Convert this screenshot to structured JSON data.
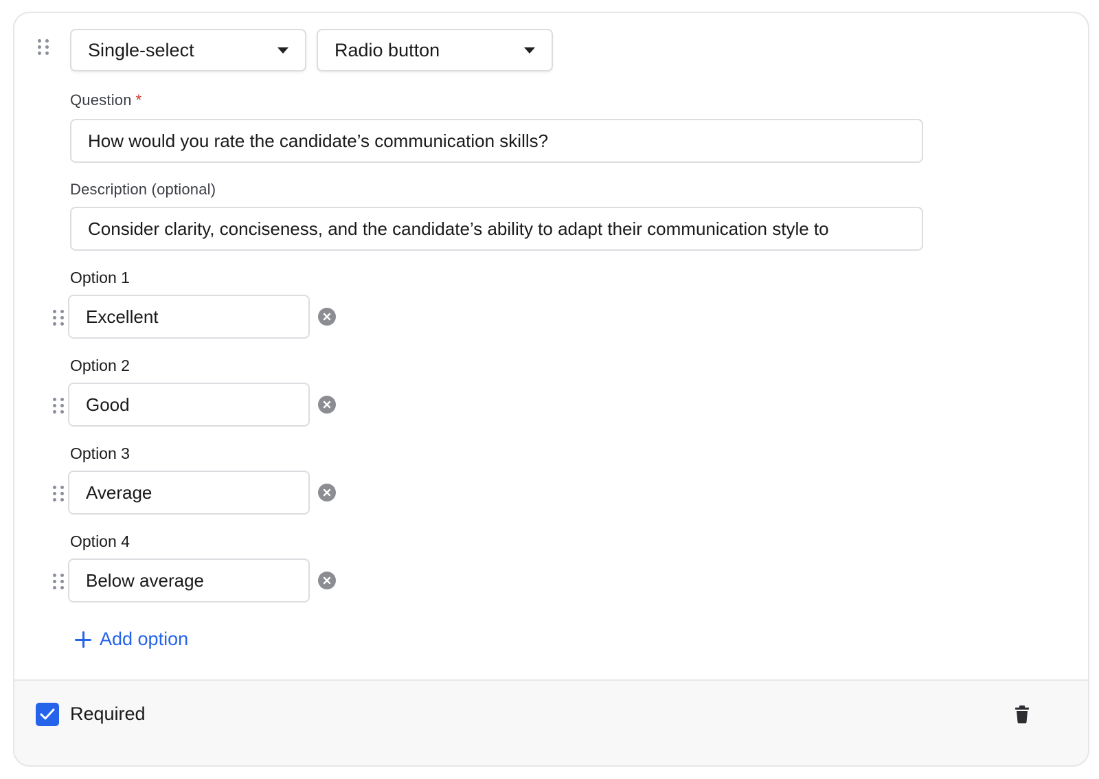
{
  "type_select": {
    "value": "Single-select",
    "icon": "chevron-down-icon"
  },
  "style_select": {
    "value": "Radio button",
    "icon": "chevron-down-icon"
  },
  "question": {
    "label": "Question",
    "required_marker": "*",
    "value": "How would you rate the candidate’s communication skills?"
  },
  "description": {
    "label": "Description (optional)",
    "value": "Consider clarity, conciseness, and the candidate’s ability to adapt their communication style to"
  },
  "options": [
    {
      "label": "Option 1",
      "value": "Excellent"
    },
    {
      "label": "Option 2",
      "value": "Good"
    },
    {
      "label": "Option 3",
      "value": "Average"
    },
    {
      "label": "Option 4",
      "value": "Below average"
    }
  ],
  "add_option": {
    "label": "Add option",
    "icon": "plus-icon"
  },
  "footer": {
    "required_label": "Required",
    "required_checked": true,
    "delete_icon": "trash-icon"
  },
  "colors": {
    "accent": "#2563eb",
    "required_star": "#c0392b",
    "border": "#dcdde1",
    "footer_bg": "#f8f8f9"
  }
}
